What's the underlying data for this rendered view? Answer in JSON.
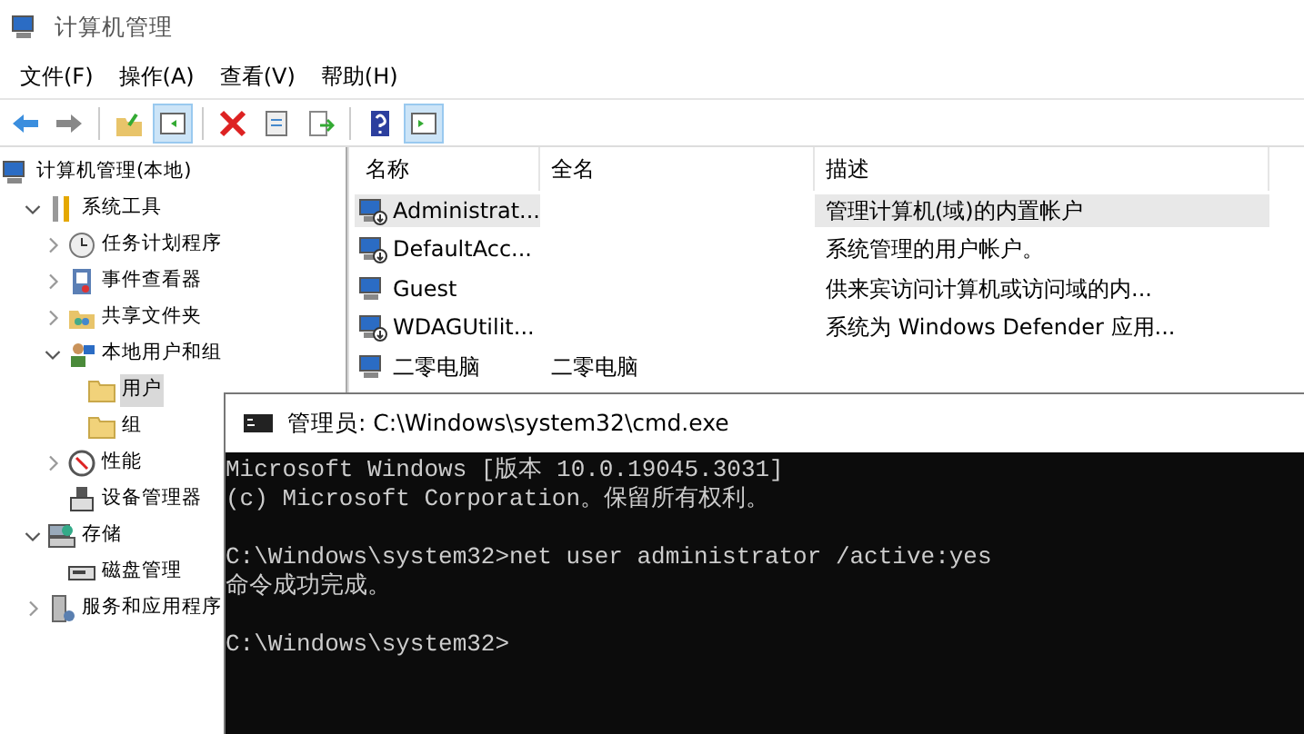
{
  "window": {
    "title": "计算机管理"
  },
  "menu": [
    "文件(F)",
    "操作(A)",
    "查看(V)",
    "帮助(H)"
  ],
  "toolbar": [
    {
      "kind": "back",
      "selected": false
    },
    {
      "kind": "forward",
      "selected": false
    },
    {
      "kind": "up",
      "selected": false
    },
    {
      "kind": "tree",
      "selected": true
    },
    {
      "kind": "delete",
      "selected": false
    },
    {
      "kind": "properties",
      "selected": false
    },
    {
      "kind": "export",
      "selected": false
    },
    {
      "kind": "help",
      "selected": false
    },
    {
      "kind": "pane",
      "selected": true
    }
  ],
  "tree": [
    {
      "label": "计算机管理(本地)",
      "kind": "computer",
      "selected": false,
      "children": [
        {
          "label": "系统工具",
          "kind": "tools",
          "expanded": true,
          "selected": false,
          "children": [
            {
              "label": "任务计划程序",
              "kind": "clock",
              "expanded": false,
              "selected": false
            },
            {
              "label": "事件查看器",
              "kind": "log",
              "expanded": false,
              "selected": false
            },
            {
              "label": "共享文件夹",
              "kind": "share",
              "expanded": false,
              "selected": false
            },
            {
              "label": "本地用户和组",
              "kind": "users",
              "expanded": true,
              "selected": false,
              "children": [
                {
                  "label": "用户",
                  "kind": "folder",
                  "selected": true
                },
                {
                  "label": "组",
                  "kind": "folder",
                  "selected": false
                }
              ]
            },
            {
              "label": "性能",
              "kind": "gauge",
              "expanded": false,
              "selected": false
            },
            {
              "label": "设备管理器",
              "kind": "device",
              "selected": false
            }
          ]
        },
        {
          "label": "存储",
          "kind": "storage",
          "expanded": true,
          "selected": false,
          "children": [
            {
              "label": "磁盘管理",
              "kind": "disk",
              "selected": false
            }
          ]
        },
        {
          "label": "服务和应用程序",
          "kind": "services",
          "expanded": false,
          "selected": false
        }
      ]
    }
  ],
  "table": {
    "columns": [
      "名称",
      "全名",
      "描述"
    ],
    "rows": [
      {
        "name": "Administrat...",
        "description": "管理计算机(域)的内置帐户",
        "disabled": true,
        "selected": true
      },
      {
        "name": "DefaultAcc...",
        "description": "系统管理的用户帐户。",
        "disabled": true,
        "selected": false
      },
      {
        "name": "Guest",
        "description": "供来宾访问计算机或访问域的内...",
        "disabled": false,
        "selected": false
      },
      {
        "name": "WDAGUtilit...",
        "description": "系统为 Windows Defender 应用...",
        "disabled": true,
        "selected": false
      },
      {
        "name": "二零电脑",
        "full_name": "二零电脑",
        "disabled": false,
        "selected": false
      }
    ]
  },
  "console": {
    "title": "管理员: C:\\Windows\\system32\\cmd.exe",
    "blocks": [
      [
        "Microsoft Windows [版本 10.0.19045.3031]",
        "(c) Microsoft Corporation。保留所有权利。"
      ],
      [
        "C:\\Windows\\system32>net user administrator /active:yes",
        "命令成功完成。"
      ],
      [
        "C:\\Windows\\system32>"
      ]
    ]
  }
}
